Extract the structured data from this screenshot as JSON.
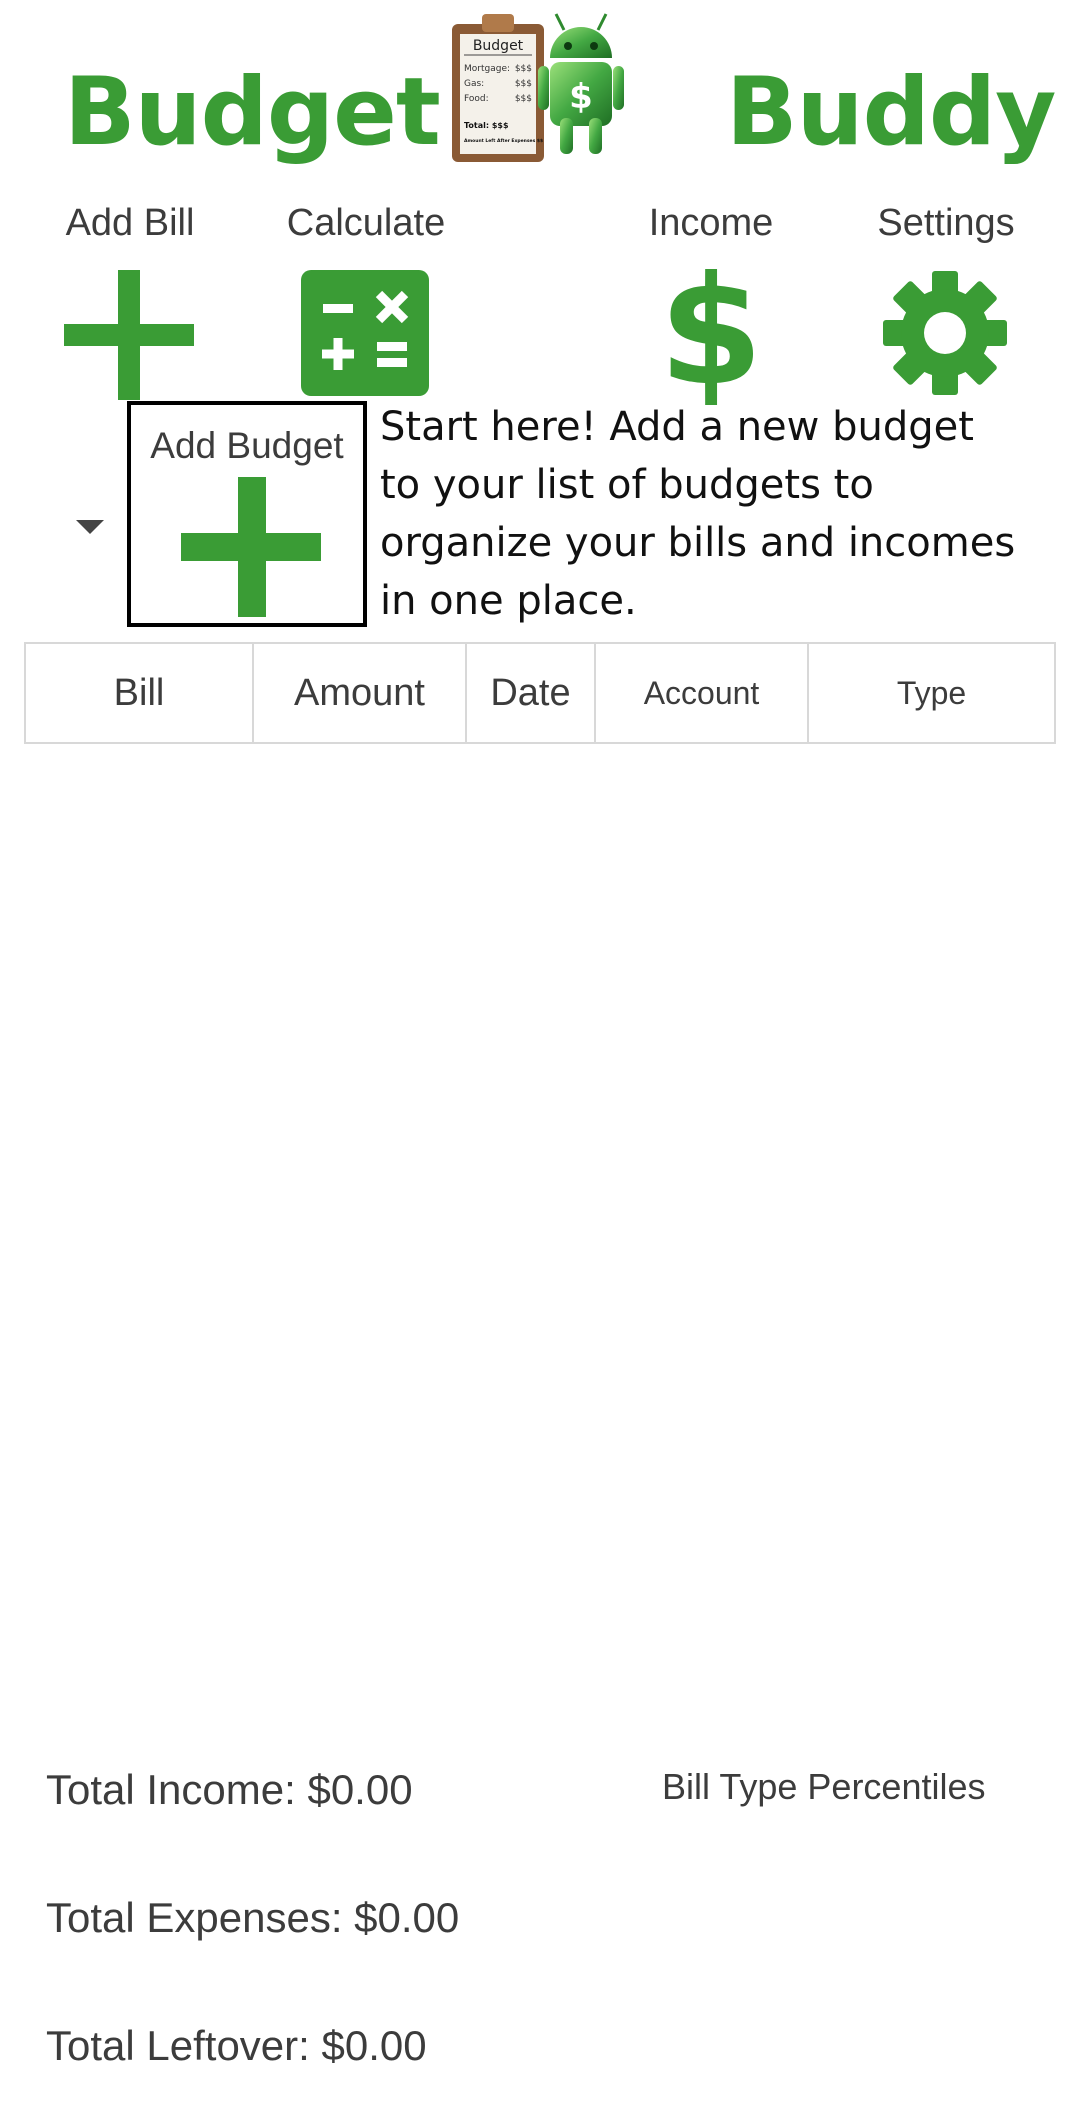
{
  "header": {
    "brand_left": "Budget",
    "brand_right": "Buddy",
    "logo": {
      "icon": "clipboard-android-mascot-icon",
      "clipboard_title": "Budget",
      "lines": [
        {
          "label": "Mortgage:",
          "value": "$$$"
        },
        {
          "label": "Gas:",
          "value": "$$$"
        },
        {
          "label": "Food:",
          "value": "$$$"
        }
      ],
      "total": "Total: $$$",
      "footnote": "Amount Left After Expenses $$",
      "mascot_symbol": "$"
    }
  },
  "toolbar": {
    "add_bill_label": "Add Bill",
    "calculate_label": "Calculate",
    "income_label": "Income",
    "settings_label": "Settings",
    "income_symbol": "$"
  },
  "budget": {
    "add_budget_label": "Add Budget",
    "hint_text": "Start here! Add a new budget to your list of budgets to organize your bills and incomes in one place."
  },
  "table": {
    "columns": [
      "Bill",
      "Amount",
      "Date",
      "Account",
      "Type"
    ]
  },
  "summary": {
    "total_income": "Total Income: $0.00",
    "total_expenses": "Total Expenses: $0.00",
    "total_leftover": "Total Leftover: $0.00",
    "bill_type_percentiles": "Bill Type Percentiles"
  },
  "colors": {
    "accent_green": "#3a9c35",
    "text_gray": "#3c3c3c",
    "border_gray": "#d8d8d8"
  }
}
